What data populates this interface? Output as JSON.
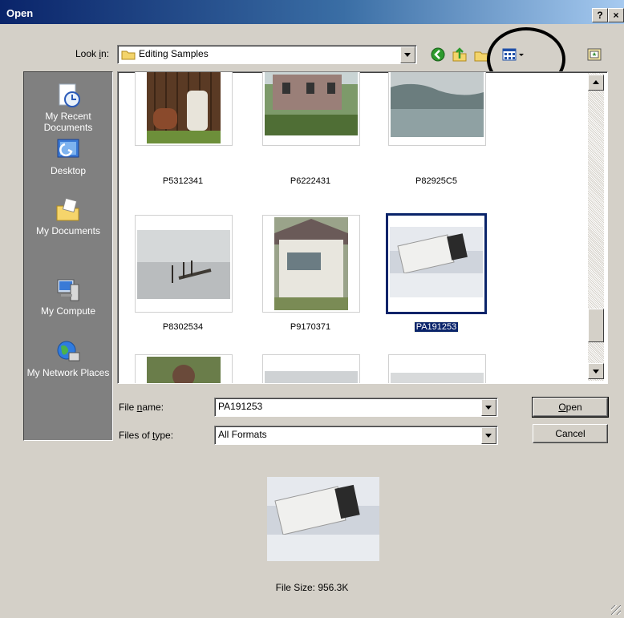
{
  "window": {
    "title": "Open",
    "help_label": "?",
    "close_label": "×"
  },
  "lookin": {
    "label": "Look in:",
    "value": "Editing Samples"
  },
  "toolbar": {
    "icons": [
      "back-icon",
      "up-folder-icon",
      "new-folder-icon",
      "views-menu-icon",
      "thumbnail-icon"
    ]
  },
  "places": [
    {
      "label": "My Recent Documents",
      "icon": "recent-documents-icon"
    },
    {
      "label": "Desktop",
      "icon": "desktop-icon"
    },
    {
      "label": "My Documents",
      "icon": "my-documents-icon"
    },
    {
      "label": "My Compute",
      "icon": "my-computer-icon"
    },
    {
      "label": "My Network Places",
      "icon": "network-places-icon"
    }
  ],
  "files": [
    {
      "name": "P5312341"
    },
    {
      "name": "P6222431"
    },
    {
      "name": "P82925C5"
    },
    {
      "name": "P8302534"
    },
    {
      "name": "P9170371"
    },
    {
      "name": "PA191253",
      "selected": true
    }
  ],
  "filename": {
    "label": "File name:",
    "value": "PA191253"
  },
  "filetype": {
    "label": "Files of type:",
    "value": "All Formats"
  },
  "buttons": {
    "open": "Open",
    "cancel": "Cancel"
  },
  "preview": {
    "file_size": "File Size: 956.3K"
  }
}
